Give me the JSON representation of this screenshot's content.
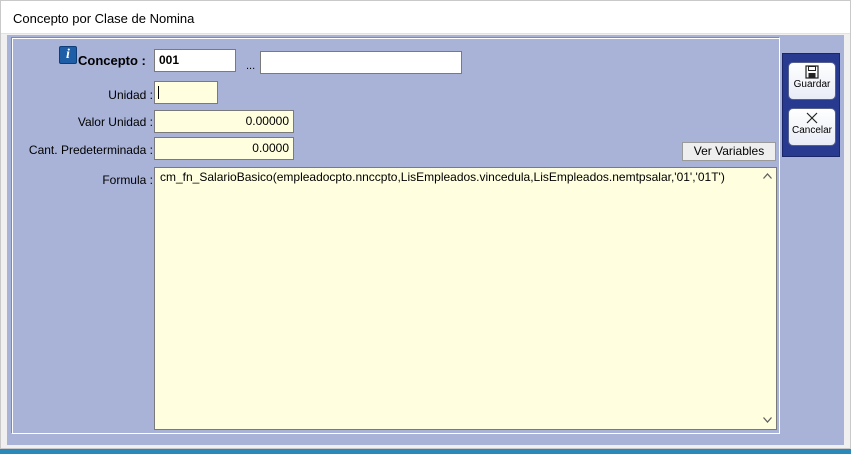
{
  "window": {
    "title": "Concepto por Clase de Nomina"
  },
  "form": {
    "concepto_label": "Concepto :",
    "concepto_code": "001",
    "ellipsis": "...",
    "concepto_desc": "",
    "unidad_label": "Unidad :",
    "unidad_value": "",
    "valor_unidad_label": "Valor Unidad :",
    "valor_unidad_value": "0.00000",
    "cant_pred_label": "Cant. Predeterminada :",
    "cant_pred_value": "0.0000",
    "formula_label": "Formula :",
    "formula_value": "cm_fn_SalarioBasico(empleadocpto.nnccpto,LisEmpleados.vincedula,LisEmpleados.nemtpsalar,'01','01T')",
    "ver_variables_label": "Ver Variables"
  },
  "toolbar": {
    "guardar_label": "Guardar",
    "cancelar_label": "Cancelar"
  },
  "icons": {
    "info": "info-icon",
    "save": "floppy-disk-icon",
    "cancel": "cancel-x-icon"
  },
  "colors": {
    "panel_bg": "#a9b3d8",
    "input_bg": "#ffffe0",
    "button_panel": "#283a8f",
    "desktop": "#2a89b8"
  }
}
